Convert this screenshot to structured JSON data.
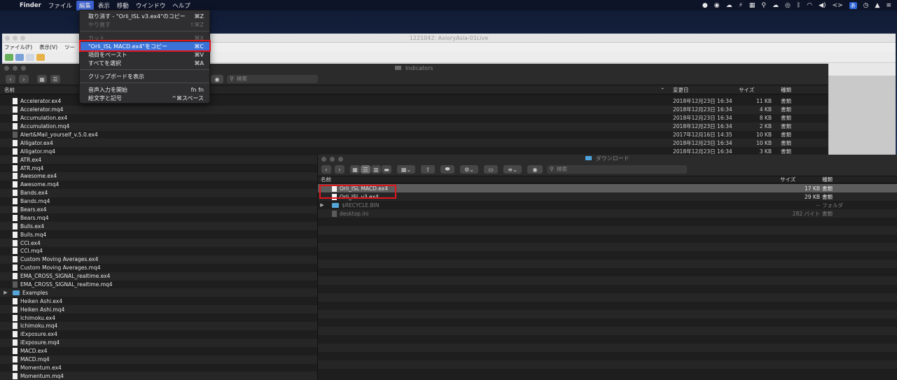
{
  "menubar": {
    "app": "Finder",
    "items": [
      "ファイル",
      "編集",
      "表示",
      "移動",
      "ウインドウ",
      "ヘルプ"
    ],
    "active_index": 1,
    "status_input_badge": "あ"
  },
  "mt4": {
    "title": "1221042: AxioryAsia-01Live",
    "menu": [
      "ファイル(F)",
      "表示(V)",
      "ツー"
    ]
  },
  "edit_menu": {
    "items": [
      {
        "label": "取り消す - \"Orli_ISL v3.ex4\"のコピー",
        "shortcut": "⌘Z",
        "state": "normal"
      },
      {
        "label": "やり直す",
        "shortcut": "⇧⌘Z",
        "state": "disabled"
      },
      {
        "sep": true
      },
      {
        "label": "カット",
        "shortcut": "⌘X",
        "state": "disabled"
      },
      {
        "label": "\"Orli_ISL MACD.ex4\"をコピー",
        "shortcut": "⌘C",
        "state": "highlighted"
      },
      {
        "label": "項目をペースト",
        "shortcut": "⌘V",
        "state": "normal"
      },
      {
        "label": "すべてを選択",
        "shortcut": "⌘A",
        "state": "normal"
      },
      {
        "sep": true
      },
      {
        "label": "クリップボードを表示",
        "shortcut": "",
        "state": "normal"
      },
      {
        "sep": true
      },
      {
        "label": "音声入力を開始",
        "shortcut": "fn fn",
        "state": "normal"
      },
      {
        "label": "絵文字と記号",
        "shortcut": "^⌘スペース",
        "state": "normal"
      }
    ]
  },
  "indicators": {
    "title": "Indicators",
    "search_placeholder": "検索",
    "columns": {
      "name": "名前",
      "date": "変更日",
      "size": "サイズ",
      "kind": "種類"
    },
    "files": [
      {
        "name": "Accelerator.ex4",
        "date": "2018年12月23日 16:34",
        "size": "11 KB",
        "kind": "書類",
        "icon": "file"
      },
      {
        "name": "Accelerator.mq4",
        "date": "2018年12月23日 16:34",
        "size": "4 KB",
        "kind": "書類",
        "icon": "file"
      },
      {
        "name": "Accumulation.ex4",
        "date": "2018年12月23日 16:34",
        "size": "8 KB",
        "kind": "書類",
        "icon": "file"
      },
      {
        "name": "Accumulation.mq4",
        "date": "2018年12月23日 16:34",
        "size": "2 KB",
        "kind": "書類",
        "icon": "file"
      },
      {
        "name": "Alert&Mail_yourself_v.5.0.ex4",
        "date": "2017年12月16日 14:35",
        "size": "10 KB",
        "kind": "書類",
        "icon": "dark"
      },
      {
        "name": "Alligator.ex4",
        "date": "2018年12月23日 16:34",
        "size": "10 KB",
        "kind": "書類",
        "icon": "file"
      },
      {
        "name": "Alligator.mq4",
        "date": "2018年12月23日 16:34",
        "size": "3 KB",
        "kind": "書類",
        "icon": "file"
      },
      {
        "name": "ATR.ex4",
        "date": "",
        "size": "",
        "kind": "",
        "icon": "file"
      },
      {
        "name": "ATR.mq4",
        "date": "",
        "size": "",
        "kind": "",
        "icon": "file"
      },
      {
        "name": "Awesome.ex4",
        "date": "",
        "size": "",
        "kind": "",
        "icon": "file"
      },
      {
        "name": "Awesome.mq4",
        "date": "",
        "size": "",
        "kind": "",
        "icon": "file"
      },
      {
        "name": "Bands.ex4",
        "date": "",
        "size": "",
        "kind": "",
        "icon": "file"
      },
      {
        "name": "Bands.mq4",
        "date": "",
        "size": "",
        "kind": "",
        "icon": "file"
      },
      {
        "name": "Bears.ex4",
        "date": "",
        "size": "",
        "kind": "",
        "icon": "file"
      },
      {
        "name": "Bears.mq4",
        "date": "",
        "size": "",
        "kind": "",
        "icon": "file"
      },
      {
        "name": "Bulls.ex4",
        "date": "",
        "size": "",
        "kind": "",
        "icon": "file"
      },
      {
        "name": "Bulls.mq4",
        "date": "",
        "size": "",
        "kind": "",
        "icon": "file"
      },
      {
        "name": "CCI.ex4",
        "date": "",
        "size": "",
        "kind": "",
        "icon": "file"
      },
      {
        "name": "CCI.mq4",
        "date": "",
        "size": "",
        "kind": "",
        "icon": "file"
      },
      {
        "name": "Custom Moving Averages.ex4",
        "date": "",
        "size": "",
        "kind": "",
        "icon": "file"
      },
      {
        "name": "Custom Moving Averages.mq4",
        "date": "",
        "size": "",
        "kind": "",
        "icon": "file"
      },
      {
        "name": "EMA_CROSS_SIGNAL_realtime.ex4",
        "date": "",
        "size": "",
        "kind": "",
        "icon": "file"
      },
      {
        "name": "EMA_CROSS_SIGNAL_realtime.mq4",
        "date": "",
        "size": "",
        "kind": "",
        "icon": "dark"
      },
      {
        "name": "Examples",
        "date": "",
        "size": "",
        "kind": "",
        "icon": "folder"
      },
      {
        "name": "Heiken Ashi.ex4",
        "date": "",
        "size": "",
        "kind": "",
        "icon": "file"
      },
      {
        "name": "Heiken Ashi.mq4",
        "date": "",
        "size": "",
        "kind": "",
        "icon": "file"
      },
      {
        "name": "Ichimoku.ex4",
        "date": "",
        "size": "",
        "kind": "",
        "icon": "file"
      },
      {
        "name": "Ichimoku.mq4",
        "date": "",
        "size": "",
        "kind": "",
        "icon": "file"
      },
      {
        "name": "iExposure.ex4",
        "date": "",
        "size": "",
        "kind": "",
        "icon": "file"
      },
      {
        "name": "iExposure.mq4",
        "date": "",
        "size": "",
        "kind": "",
        "icon": "file"
      },
      {
        "name": "MACD.ex4",
        "date": "",
        "size": "",
        "kind": "",
        "icon": "file"
      },
      {
        "name": "MACD.mq4",
        "date": "",
        "size": "",
        "kind": "",
        "icon": "file"
      },
      {
        "name": "Momentum.ex4",
        "date": "",
        "size": "",
        "kind": "",
        "icon": "file"
      },
      {
        "name": "Momentum.mq4",
        "date": "",
        "size": "",
        "kind": "",
        "icon": "file"
      }
    ]
  },
  "downloads": {
    "title": "ダウンロード",
    "search_placeholder": "検索",
    "columns": {
      "name": "名前",
      "size": "サイズ",
      "kind": "種類"
    },
    "files": [
      {
        "name": "Orli_ISL MACD.ex4",
        "size": "17 KB",
        "kind": "書類",
        "icon": "file",
        "selected": true
      },
      {
        "name": "Orli_ISL v3.ex4",
        "size": "29 KB",
        "kind": "書類",
        "icon": "file"
      },
      {
        "name": "$RECYCLE.BIN",
        "size": "--",
        "kind": "フォルダ",
        "icon": "folder",
        "dim": true
      },
      {
        "name": "desktop.ini",
        "size": "282 バイト",
        "kind": "書類",
        "icon": "dark",
        "dim": true
      }
    ]
  },
  "colors": {
    "highlight": "#3a72d8",
    "annotation": "#e0151c"
  }
}
